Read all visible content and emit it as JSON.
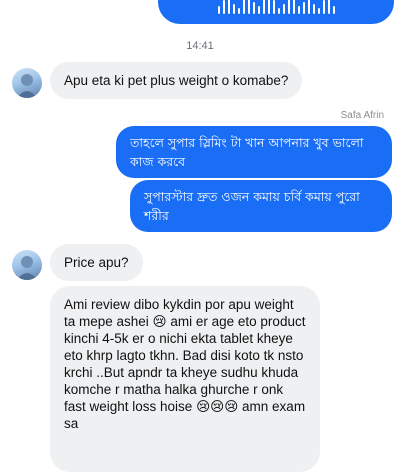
{
  "timestamp": "14:41",
  "messages": {
    "q1": "Apu eta ki pet plus weight o komabe?",
    "sender": "Safa Afrin",
    "reply1": "তাহলে সুপার স্লিমিং টা খান আপনার খুব ভালো কাজ করবে",
    "reply2": "সুপারস্টার দ্রুত ওজন কমায় চর্বি কমায় পুরো শরীর",
    "q2": "Price apu?",
    "review": "Ami review dibo kykdin por apu weight ta mepe ashei 😢 ami er age eto product kinchi 4-5k er o nichi ekta tablet kheye eto khrp lagto tkhn. Bad disi  koto tk nsto krchi  ..But apndr ta kheye sudhu khuda komche r matha halka ghurche r onk fast weight loss hoise 😢😢😢 amn exam sa"
  },
  "colors": {
    "outgoing": "#1a6ef5",
    "incoming": "#eef0f2"
  }
}
